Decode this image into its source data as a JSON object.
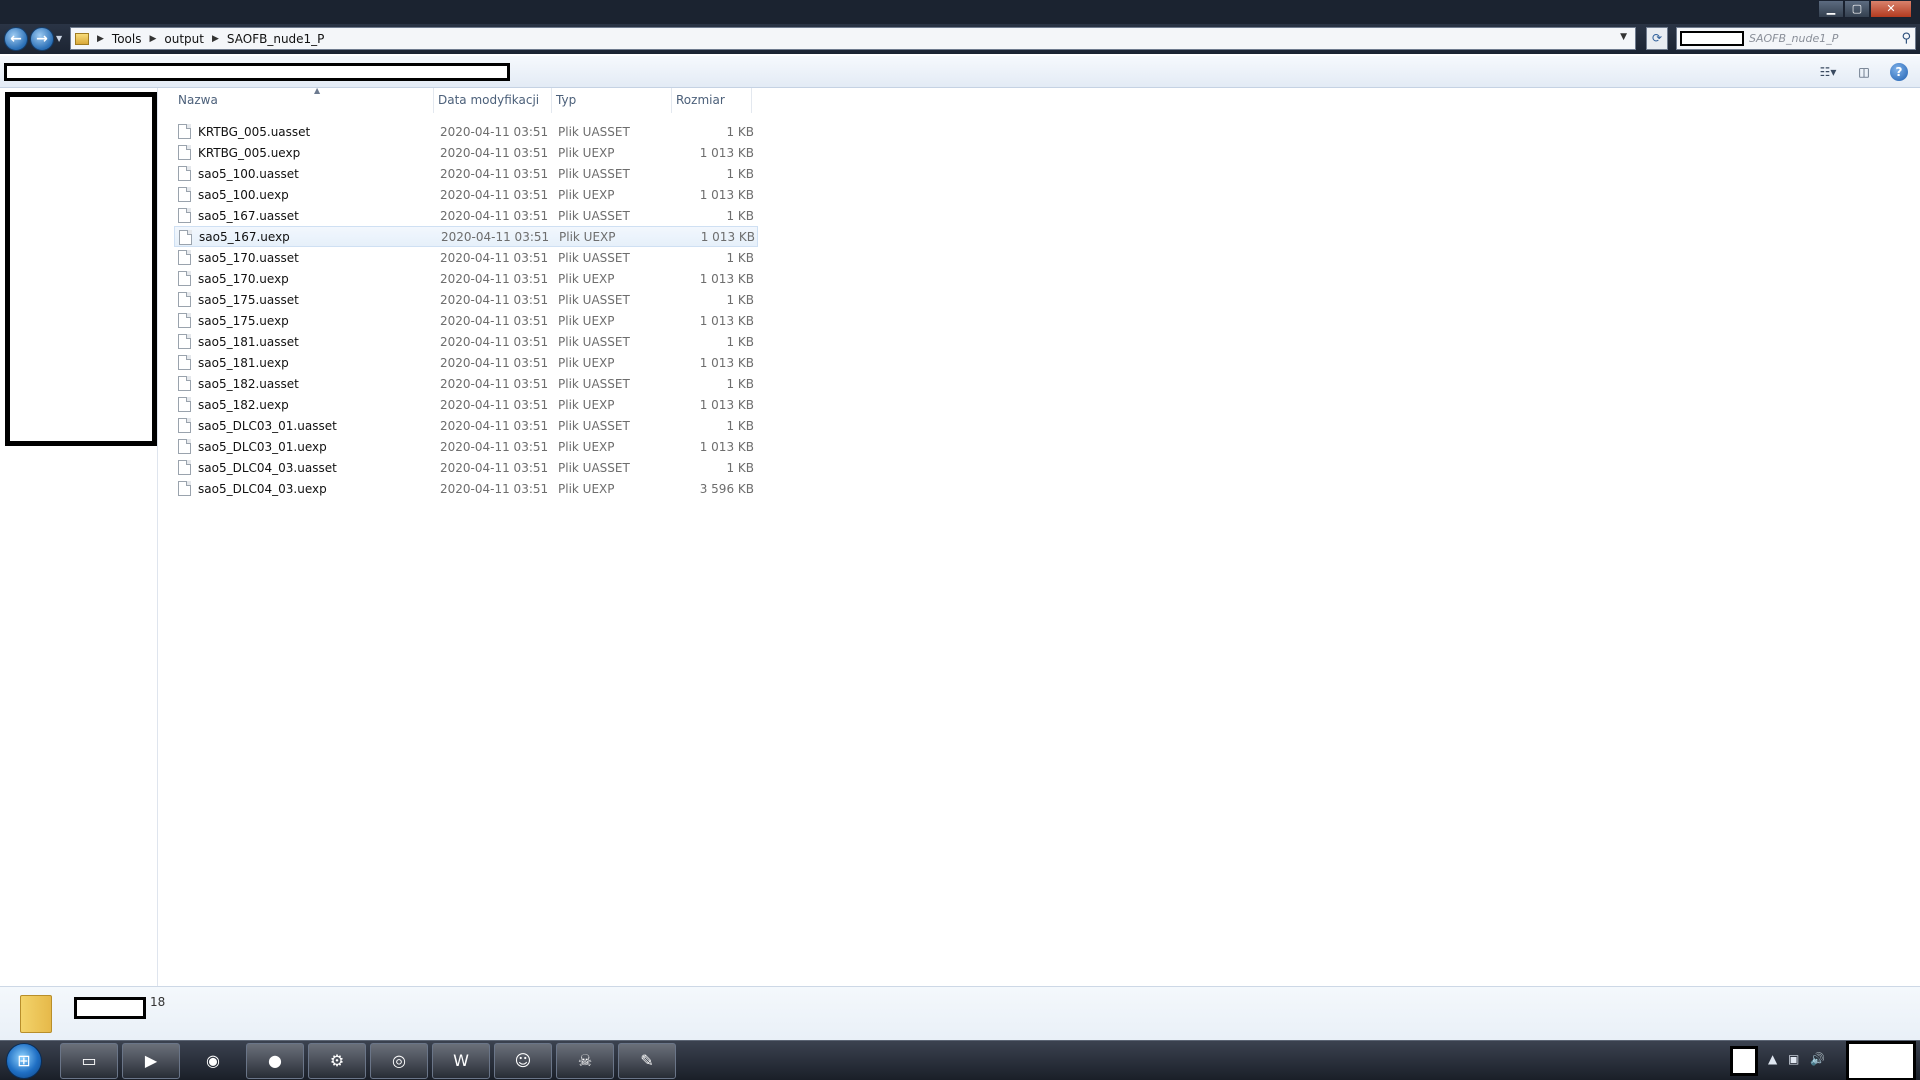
{
  "window": {
    "ghost_tabs": [
      "",
      "",
      "",
      ""
    ],
    "controls": {
      "minimize": "▁",
      "maximize": "▢",
      "close": "✕"
    }
  },
  "navigation": {
    "back_glyph": "←",
    "forward_glyph": "→",
    "breadcrumb": [
      "Tools",
      "output",
      "SAOFB_nude1_P"
    ],
    "search_placeholder": "SAOFB_nude1_P"
  },
  "columns": {
    "name": "Nazwa",
    "date": "Data modyfikacji",
    "type": "Typ",
    "size": "Rozmiar"
  },
  "files": [
    {
      "name": "KRTBG_005.uasset",
      "date": "2020-04-11 03:51",
      "type": "Plik UASSET",
      "size": "1 KB"
    },
    {
      "name": "KRTBG_005.uexp",
      "date": "2020-04-11 03:51",
      "type": "Plik UEXP",
      "size": "1 013 KB"
    },
    {
      "name": "sao5_100.uasset",
      "date": "2020-04-11 03:51",
      "type": "Plik UASSET",
      "size": "1 KB"
    },
    {
      "name": "sao5_100.uexp",
      "date": "2020-04-11 03:51",
      "type": "Plik UEXP",
      "size": "1 013 KB"
    },
    {
      "name": "sao5_167.uasset",
      "date": "2020-04-11 03:51",
      "type": "Plik UASSET",
      "size": "1 KB"
    },
    {
      "name": "sao5_167.uexp",
      "date": "2020-04-11 03:51",
      "type": "Plik UEXP",
      "size": "1 013 KB"
    },
    {
      "name": "sao5_170.uasset",
      "date": "2020-04-11 03:51",
      "type": "Plik UASSET",
      "size": "1 KB"
    },
    {
      "name": "sao5_170.uexp",
      "date": "2020-04-11 03:51",
      "type": "Plik UEXP",
      "size": "1 013 KB"
    },
    {
      "name": "sao5_175.uasset",
      "date": "2020-04-11 03:51",
      "type": "Plik UASSET",
      "size": "1 KB"
    },
    {
      "name": "sao5_175.uexp",
      "date": "2020-04-11 03:51",
      "type": "Plik UEXP",
      "size": "1 013 KB"
    },
    {
      "name": "sao5_181.uasset",
      "date": "2020-04-11 03:51",
      "type": "Plik UASSET",
      "size": "1 KB"
    },
    {
      "name": "sao5_181.uexp",
      "date": "2020-04-11 03:51",
      "type": "Plik UEXP",
      "size": "1 013 KB"
    },
    {
      "name": "sao5_182.uasset",
      "date": "2020-04-11 03:51",
      "type": "Plik UASSET",
      "size": "1 KB"
    },
    {
      "name": "sao5_182.uexp",
      "date": "2020-04-11 03:51",
      "type": "Plik UEXP",
      "size": "1 013 KB"
    },
    {
      "name": "sao5_DLC03_01.uasset",
      "date": "2020-04-11 03:51",
      "type": "Plik UASSET",
      "size": "1 KB"
    },
    {
      "name": "sao5_DLC03_01.uexp",
      "date": "2020-04-11 03:51",
      "type": "Plik UEXP",
      "size": "1 013 KB"
    },
    {
      "name": "sao5_DLC04_03.uasset",
      "date": "2020-04-11 03:51",
      "type": "Plik UASSET",
      "size": "1 KB"
    },
    {
      "name": "sao5_DLC04_03.uexp",
      "date": "2020-04-11 03:51",
      "type": "Plik UEXP",
      "size": "3 596 KB"
    }
  ],
  "hovered_row": "sao5_167.uexp",
  "details": {
    "item_count": "18"
  },
  "taskbar": {
    "apps": [
      {
        "name": "windows-explorer-icon",
        "glyph": "▭"
      },
      {
        "name": "media-player-icon",
        "glyph": "▶"
      },
      {
        "name": "chrome-icon",
        "glyph": "◉"
      },
      {
        "name": "red-app-icon",
        "glyph": "●"
      },
      {
        "name": "steam-icon",
        "glyph": "⚙"
      },
      {
        "name": "uplay-icon",
        "glyph": "◎"
      },
      {
        "name": "word-icon",
        "glyph": "W"
      },
      {
        "name": "discord-icon",
        "glyph": "☺"
      },
      {
        "name": "skull-app-icon",
        "glyph": "☠"
      },
      {
        "name": "paint-icon",
        "glyph": "✎"
      }
    ],
    "tray_glyphs": {
      "arrow": "▲",
      "network": "▣",
      "volume": "🔊"
    }
  },
  "colors": {
    "accent": "#2a6fb6",
    "hover_row": "#e6f0fa",
    "muted_text": "#6d6d6d"
  }
}
